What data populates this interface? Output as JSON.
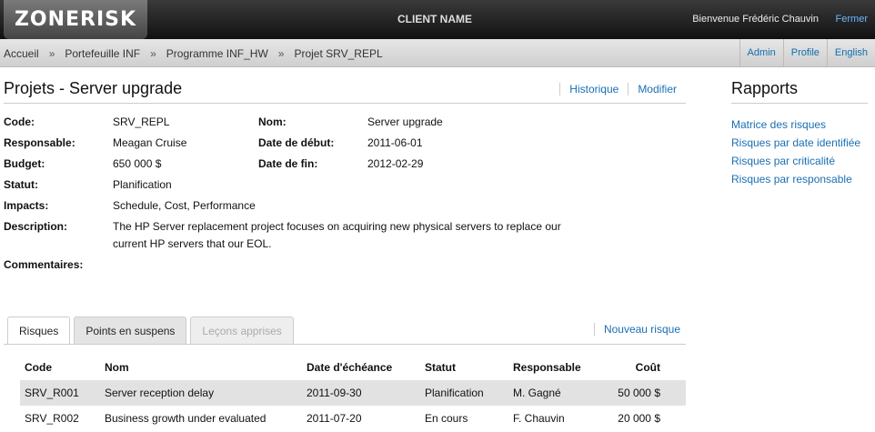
{
  "header": {
    "logo": "ZONERISK",
    "client_name": "CLIENT NAME",
    "welcome": "Bienvenue Frédéric Chauvin",
    "close": "Fermer"
  },
  "breadcrumb": [
    "Accueil",
    "Portefeuille INF",
    "Programme INF_HW",
    "Projet SRV_REPL"
  ],
  "breadcrumb_sep": "»",
  "topnav": [
    "Admin",
    "Profile",
    "English"
  ],
  "page": {
    "title": "Projets - Server upgrade",
    "actions": [
      "Historique",
      "Modifier"
    ]
  },
  "details": {
    "code_label": "Code:",
    "code": "SRV_REPL",
    "nom_label": "Nom:",
    "nom": "Server upgrade",
    "resp_label": "Responsable:",
    "resp": "Meagan Cruise",
    "debut_label": "Date de début:",
    "debut": "2011-06-01",
    "budget_label": "Budget:",
    "budget": "650 000 $",
    "fin_label": "Date de fin:",
    "fin": "2012-02-29",
    "statut_label": "Statut:",
    "statut": "Planification",
    "impacts_label": "Impacts:",
    "impacts": "Schedule, Cost, Performance",
    "desc_label": "Description:",
    "desc_line1": "The HP Server replacement project focuses on acquiring new physical servers to replace our",
    "desc_line2": "current HP servers that our EOL.",
    "comments_label": "Commentaires:"
  },
  "rapports": {
    "title": "Rapports",
    "links": [
      "Matrice des risques",
      "Risques par date identifiée",
      "Risques par criticalité",
      "Risques par responsable"
    ]
  },
  "tabs": [
    {
      "label": "Risques",
      "state": "active"
    },
    {
      "label": "Points en suspens",
      "state": "normal"
    },
    {
      "label": "Leçons apprises",
      "state": "disabled"
    }
  ],
  "new_risk": "Nouveau risque",
  "table": {
    "headers": [
      "Code",
      "Nom",
      "Date d'échéance",
      "Statut",
      "Responsable",
      "Coût"
    ],
    "rows": [
      [
        "SRV_R001",
        "Server reception delay",
        "2011-09-30",
        "Planification",
        "M. Gagné",
        "50 000 $"
      ],
      [
        "SRV_R002",
        "Business growth under evaluated",
        "2011-07-20",
        "En cours",
        "F. Chauvin",
        "20 000 $"
      ]
    ]
  }
}
